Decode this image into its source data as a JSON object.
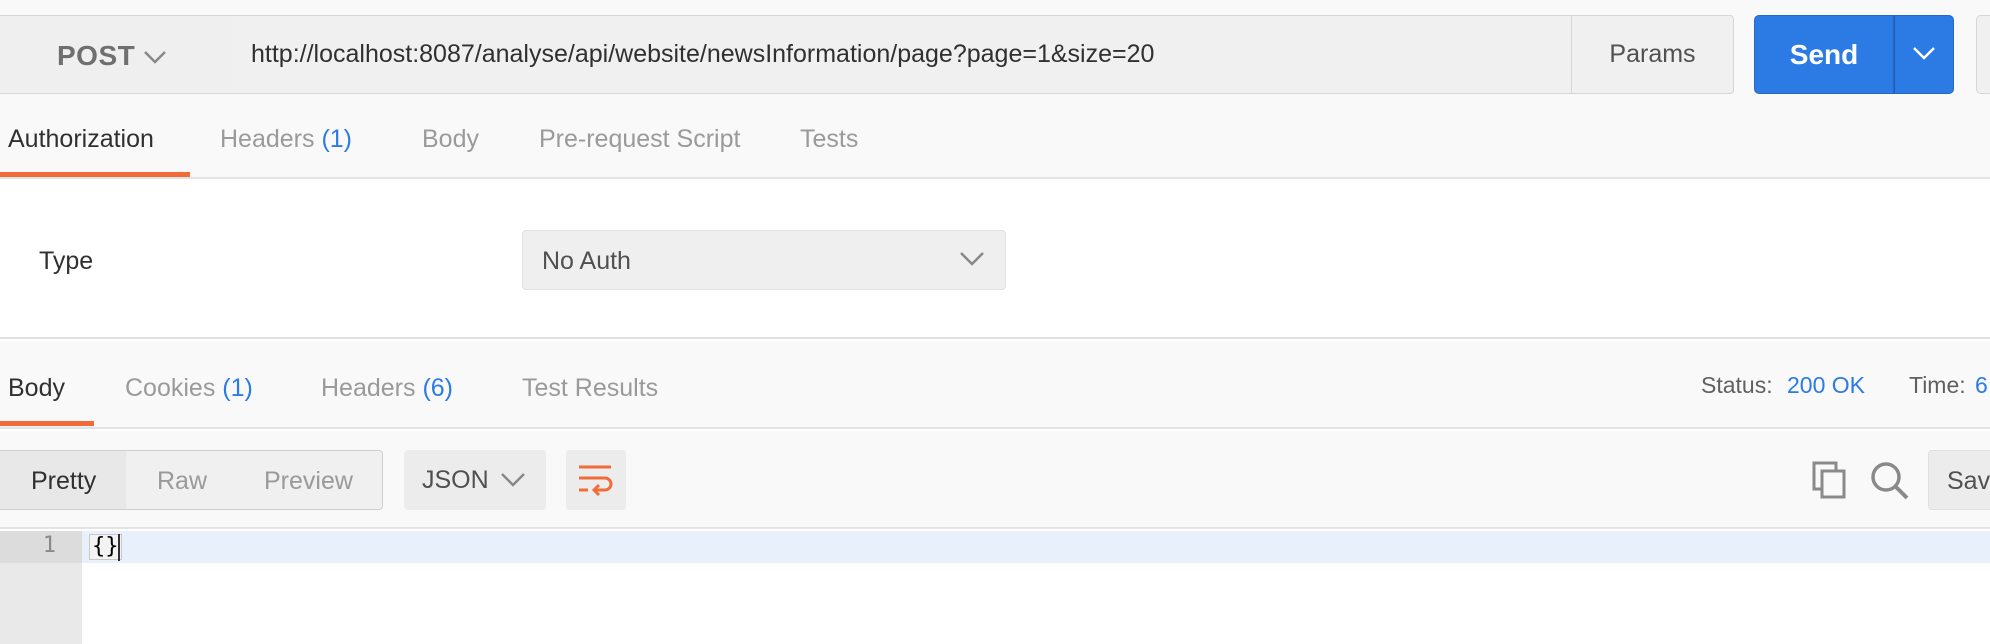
{
  "request": {
    "method": "POST",
    "url": "http://localhost:8087/analyse/api/website/newsInformation/page?page=1&size=20",
    "params_label": "Params",
    "send_label": "Send"
  },
  "request_tabs": [
    {
      "label": "Authorization",
      "count": ""
    },
    {
      "label": "Headers",
      "count": "(1)"
    },
    {
      "label": "Body",
      "count": ""
    },
    {
      "label": "Pre-request Script",
      "count": ""
    },
    {
      "label": "Tests",
      "count": ""
    }
  ],
  "auth": {
    "type_label": "Type",
    "type_value": "No Auth"
  },
  "response_tabs": [
    {
      "label": "Body",
      "count": ""
    },
    {
      "label": "Cookies",
      "count": "(1)"
    },
    {
      "label": "Headers",
      "count": "(6)"
    },
    {
      "label": "Test Results",
      "count": ""
    }
  ],
  "response_meta": {
    "status_label": "Status:",
    "status_value": "200 OK",
    "time_label": "Time:",
    "time_value": "6"
  },
  "response_toolbar": {
    "view_options": [
      "Pretty",
      "Raw",
      "Preview"
    ],
    "format": "JSON",
    "save_label": "Save"
  },
  "code": {
    "line_number": "1",
    "content": "{}"
  },
  "colors": {
    "accent_blue": "#2c7be5",
    "accent_orange": "#f26b3a"
  }
}
